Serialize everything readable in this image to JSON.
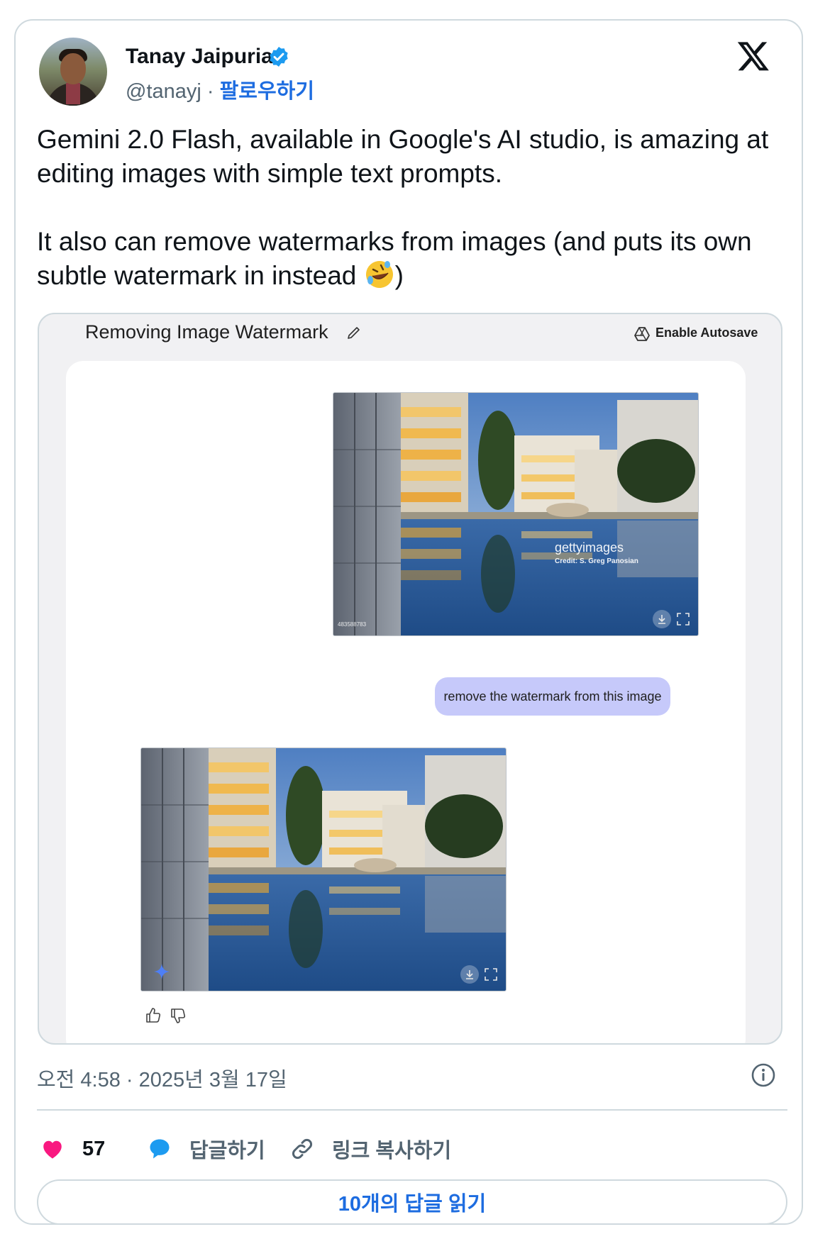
{
  "author": {
    "name": "Tanay Jaipuria",
    "handle": "@tanayj",
    "separator": " · ",
    "follow_label": "팔로우하기"
  },
  "tweet": {
    "paragraph_1": "Gemini 2.0 Flash, available in Google's AI studio, is amazing at editing images with simple text prompts.",
    "paragraph_2": "It also can remove watermarks from images (and puts its own subtle watermark in instead ",
    "paragraph_2_end": ")"
  },
  "media": {
    "title": "Removing Image Watermark",
    "autosave_label": "Enable Autosave",
    "watermark_brand": "gettyimages",
    "watermark_credit": "Credit: S. Greg Panosian",
    "image_id": "483588783",
    "prompt": "remove the watermark from this image"
  },
  "footer": {
    "timestamp": "오전 4:58 · 2025년 3월 17일",
    "like_count": "57",
    "reply_label": "답글하기",
    "copy_link_label": "링크 복사하기",
    "read_replies_label": "10개의 답글 읽기"
  },
  "colors": {
    "link_blue": "#1d6ce0",
    "like_red": "#f91880",
    "reply_blue": "#1d9bf0",
    "prompt_bubble": "#c6c9fa",
    "border": "#cfd9de"
  },
  "icons": [
    "verified-badge-icon",
    "x-logo-icon",
    "pencil-icon",
    "drive-icon",
    "download-icon",
    "expand-icon",
    "gemini-spark-icon",
    "thumb-up-icon",
    "thumb-down-icon",
    "info-icon",
    "heart-icon",
    "reply-bubble-icon",
    "link-icon",
    "rofl-emoji"
  ]
}
